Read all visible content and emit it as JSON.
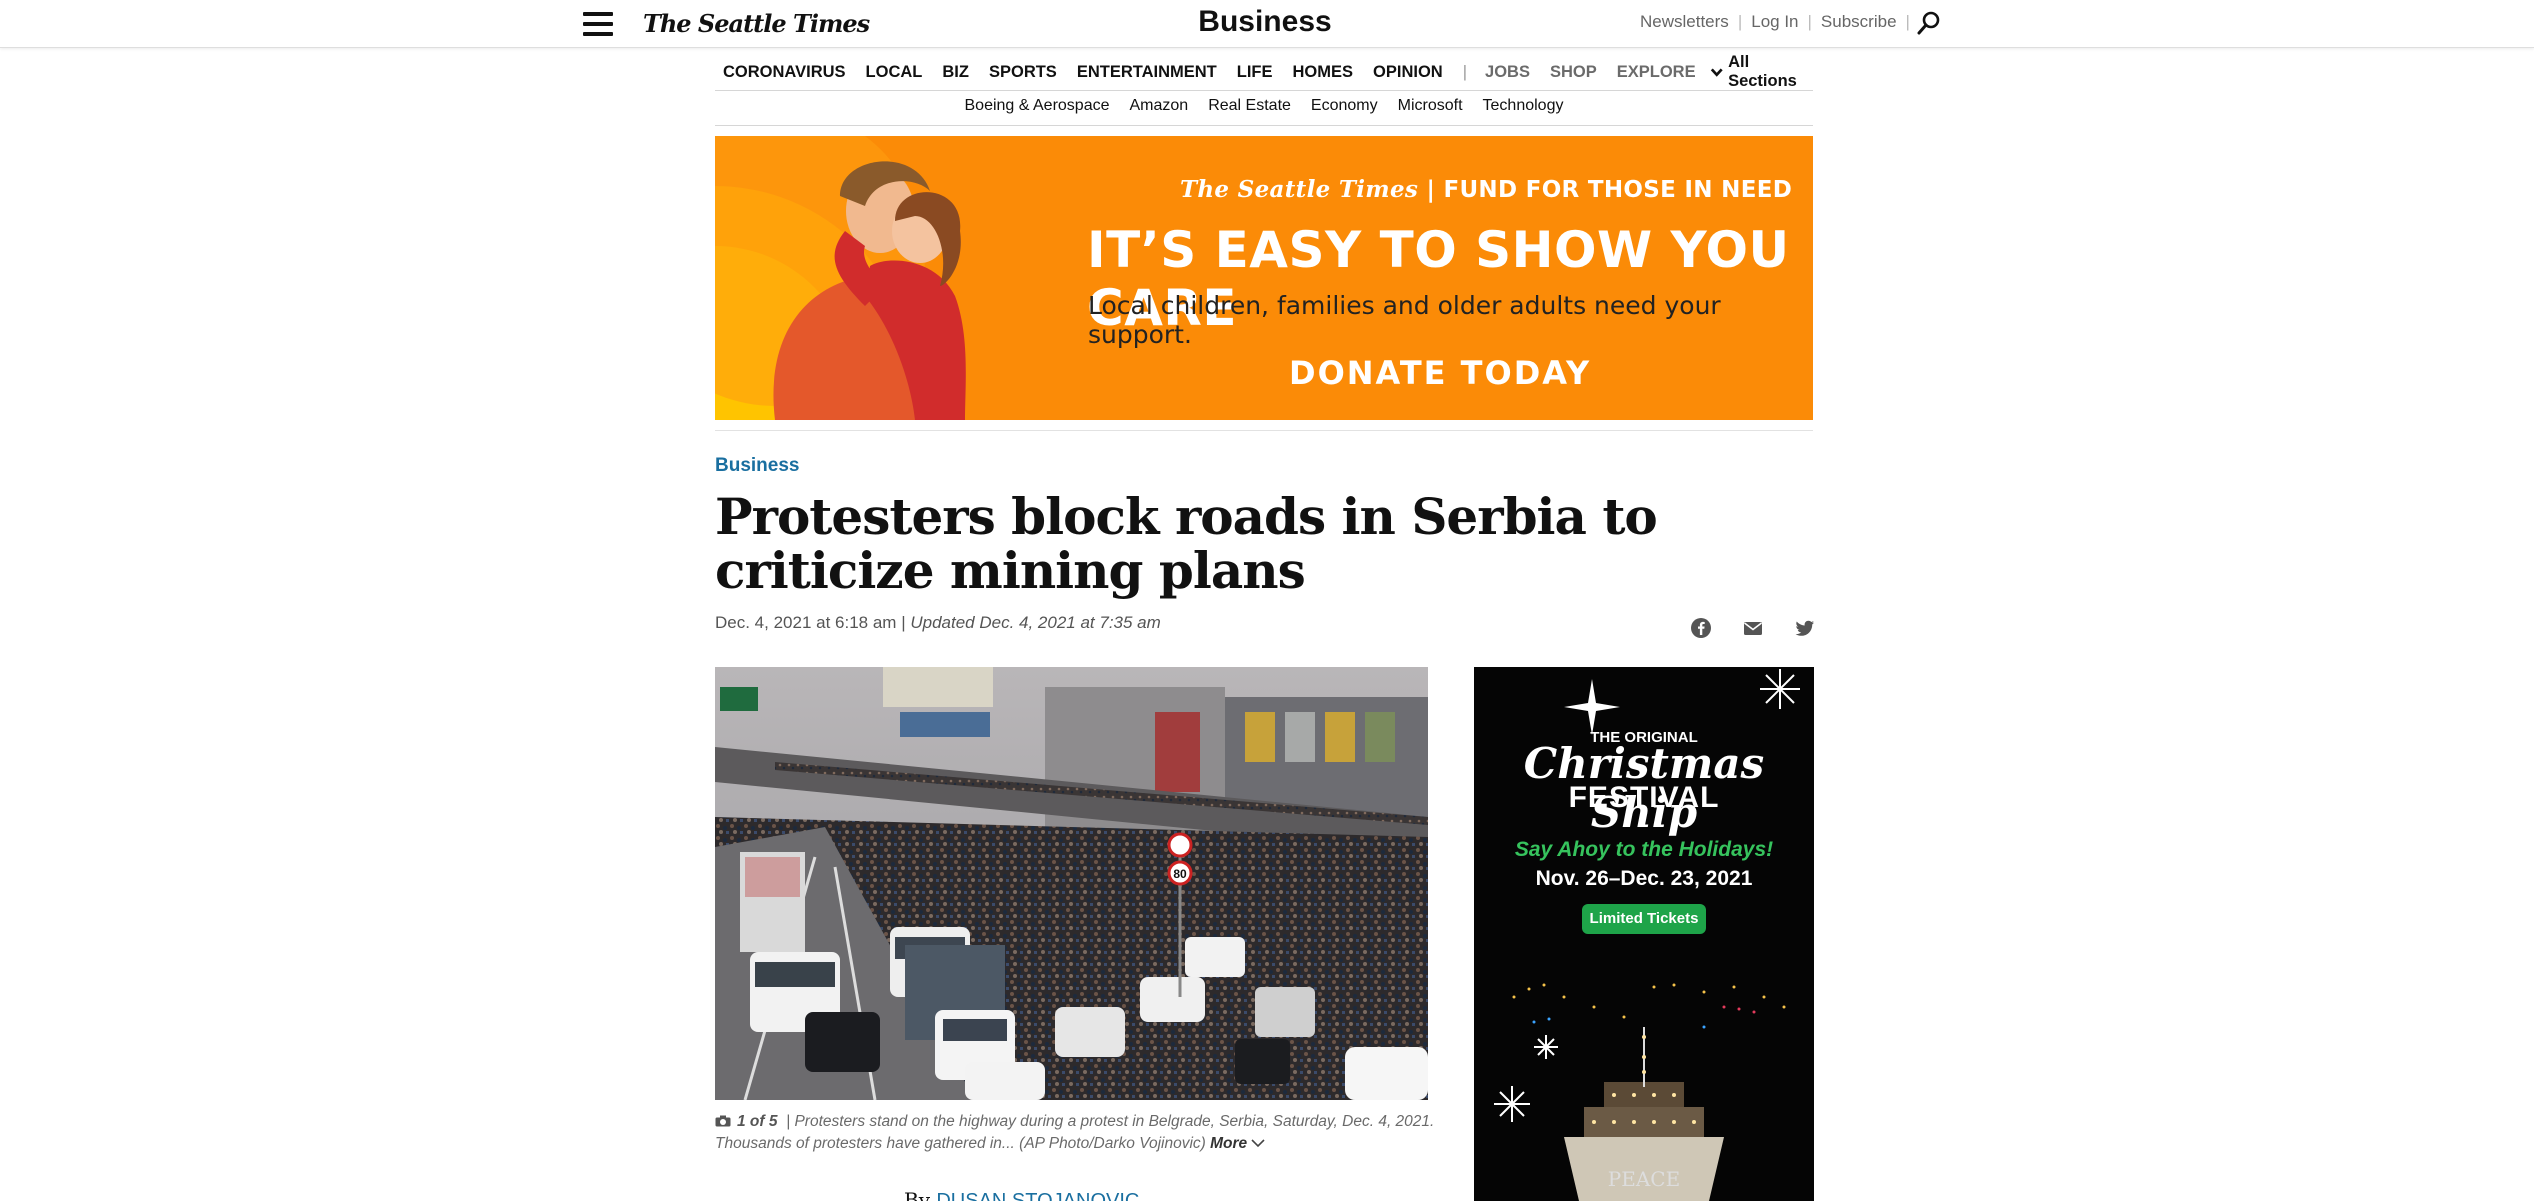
{
  "header": {
    "logo": "The Seattle Times",
    "section_title": "Business",
    "links": [
      "Newsletters",
      "Log In",
      "Subscribe"
    ]
  },
  "nav": {
    "primary": [
      "CORONAVIRUS",
      "LOCAL",
      "BIZ",
      "SPORTS",
      "ENTERTAINMENT",
      "LIFE",
      "HOMES",
      "OPINION"
    ],
    "secondary": [
      "JOBS",
      "SHOP",
      "EXPLORE"
    ],
    "all_sections": "All Sections",
    "sub": [
      "Boeing & Aerospace",
      "Amazon",
      "Real Estate",
      "Economy",
      "Microsoft",
      "Technology"
    ]
  },
  "banner_ad": {
    "fund_logo": "The Seattle Times",
    "fund_text": "| FUND FOR THOSE IN NEED",
    "headline": "IT’S EASY TO SHOW YOU CARE",
    "tagline": "Local children, families and older adults need your support.",
    "cta": "DONATE TODAY",
    "bg_color": "#fb8b07"
  },
  "article": {
    "kicker": "Business",
    "headline": "Protesters block roads in Serbia to criticize mining plans",
    "published": "Dec. 4, 2021 at 6:18 am",
    "separator": "|",
    "updated": "Updated Dec. 4, 2021 at 7:35 am",
    "share_icons": [
      "facebook-icon",
      "email-icon",
      "twitter-icon"
    ],
    "photo": {
      "count": "1 of 5",
      "caption": "| Protesters stand on the highway during a protest in Belgrade, Serbia, Saturday, Dec. 4, 2021. Thousands of protesters have gathered in... (AP Photo/Darko Vojinovic)",
      "more": "More"
    },
    "byline_prefix": "By",
    "author": "DUSAN STOJANOVIC"
  },
  "side_ad": {
    "line1": "THE ORIGINAL",
    "line2": "Christmas Ship",
    "line3": "FESTIVAL",
    "ahoy": "Say Ahoy to the Holidays!",
    "dates": "Nov. 26–Dec. 23, 2021",
    "button": "Limited Tickets",
    "boat_text": "PEACE"
  },
  "colors": {
    "kicker_blue": "#1a6fa0",
    "ad_green": "#1ea449"
  }
}
